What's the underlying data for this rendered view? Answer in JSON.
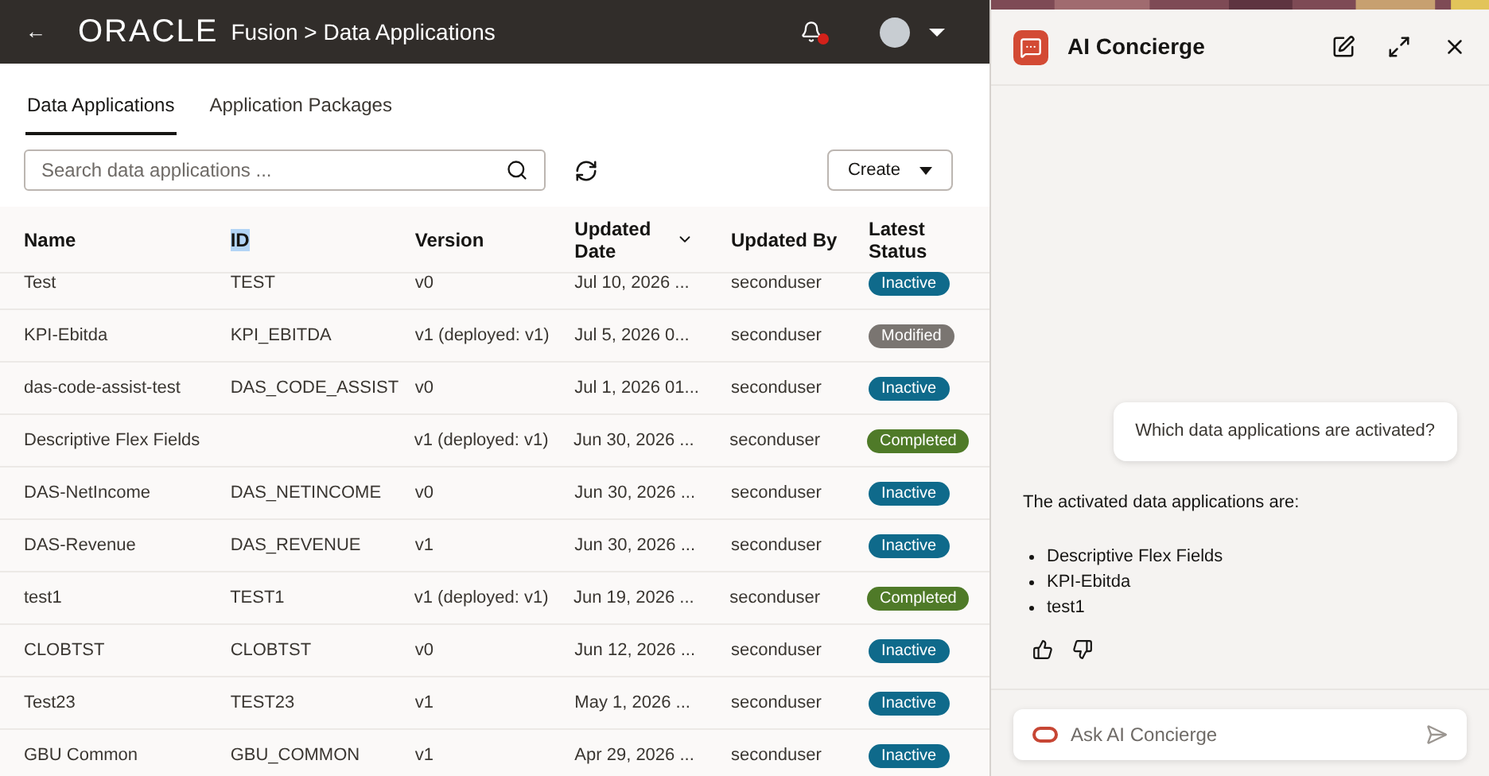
{
  "header": {
    "back": "←",
    "logo": "ORACLE",
    "title": "Fusion > Data Applications"
  },
  "tabs": [
    {
      "label": "Data Applications",
      "selected": true
    },
    {
      "label": "Application Packages",
      "selected": false
    }
  ],
  "search": {
    "placeholder": "Search data applications ..."
  },
  "create_button": "Create",
  "table": {
    "columns": [
      {
        "label": "Name",
        "selected": false
      },
      {
        "label": "ID",
        "selected": true
      },
      {
        "label": "Version",
        "selected": false
      },
      {
        "label": "Updated Date",
        "selected": false,
        "sorted": true
      },
      {
        "label": "Updated By",
        "selected": false
      },
      {
        "label": "Latest Status",
        "selected": false
      }
    ],
    "rows": [
      {
        "name": "Test",
        "id": "TEST",
        "version": "v0",
        "updated_date": "Jul 10, 2026 ...",
        "updated_by": "seconduser",
        "status": {
          "label": "Inactive",
          "color": "#0f6a8b"
        }
      },
      {
        "name": "KPI-Ebitda",
        "id": "KPI_EBITDA",
        "version": "v1 (deployed: v1)",
        "updated_date": "Jul 5, 2026 0...",
        "updated_by": "seconduser",
        "status": {
          "label": "Modified",
          "color": "#7a7571"
        }
      },
      {
        "name": "das-code-assist-test",
        "id": "DAS_CODE_ASSIST",
        "version": "v0",
        "updated_date": "Jul 1, 2026 01...",
        "updated_by": "seconduser",
        "status": {
          "label": "Inactive",
          "color": "#0f6a8b"
        }
      },
      {
        "name": "Descriptive Flex Fields",
        "version": "v1 (deployed: v1)",
        "updated_date": "Jun 30, 2026 ...",
        "updated_by": "seconduser",
        "status": {
          "label": "Completed",
          "color": "#4f7a28"
        }
      },
      {
        "name": "DAS-NetIncome",
        "id": "DAS_NETINCOME",
        "version": "v0",
        "updated_date": "Jun 30, 2026 ...",
        "updated_by": "seconduser",
        "status": {
          "label": "Inactive",
          "color": "#0f6a8b"
        }
      },
      {
        "name": "DAS-Revenue",
        "id": "DAS_REVENUE",
        "version": "v1",
        "updated_date": "Jun 30, 2026 ...",
        "updated_by": "seconduser",
        "status": {
          "label": "Inactive",
          "color": "#0f6a8b"
        }
      },
      {
        "name": "test1",
        "id": "TEST1",
        "version": "v1 (deployed: v1)",
        "updated_date": "Jun 19, 2026 ...",
        "updated_by": "seconduser",
        "status": {
          "label": "Completed",
          "color": "#4f7a28"
        }
      },
      {
        "name": "CLOBTST",
        "id": "CLOBTST",
        "version": "v0",
        "updated_date": "Jun 12, 2026 ...",
        "updated_by": "seconduser",
        "status": {
          "label": "Inactive",
          "color": "#0f6a8b"
        }
      },
      {
        "name": "Test23",
        "id": "TEST23",
        "version": "v1",
        "updated_date": "May 1, 2026 ...",
        "updated_by": "seconduser",
        "status": {
          "label": "Inactive",
          "color": "#0f6a8b"
        }
      },
      {
        "name": "GBU Common",
        "id": "GBU_COMMON",
        "version": "v1",
        "updated_date": "Apr 29, 2026 ...",
        "updated_by": "seconduser",
        "status": {
          "label": "Inactive",
          "color": "#0f6a8b"
        }
      }
    ]
  },
  "concierge": {
    "title": "AI Concierge",
    "messages": [
      {
        "kind": "user",
        "text": "Which data applications are activated?"
      },
      {
        "kind": "assistant",
        "text": "The activated data applications are:",
        "items": [
          "Descriptive Flex Fields",
          "KPI-Ebitda",
          "test1"
        ]
      }
    ],
    "input": {
      "placeholder": "Ask AI Concierge"
    }
  }
}
